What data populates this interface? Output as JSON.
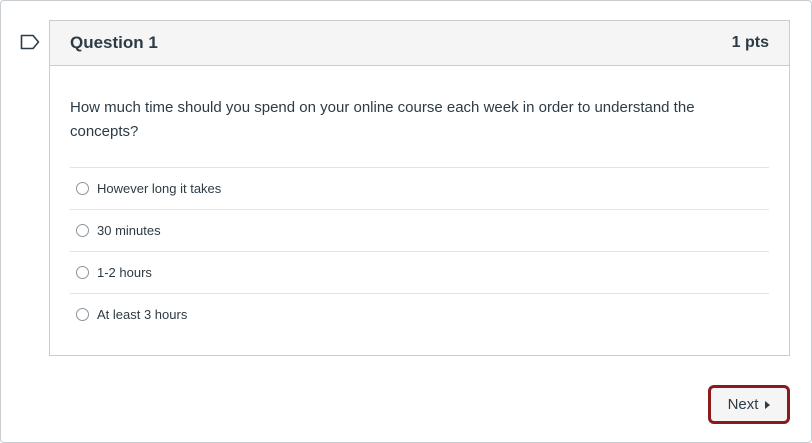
{
  "question": {
    "title": "Question 1",
    "points": "1 pts",
    "text": "How much time should you spend on your online course each week in order to understand the concepts?",
    "answers": [
      {
        "label": "However long it takes"
      },
      {
        "label": "30 minutes"
      },
      {
        "label": "1-2 hours"
      },
      {
        "label": "At least 3 hours"
      }
    ]
  },
  "navigation": {
    "next_label": "Next"
  },
  "icons": {
    "flag": "bookmark-flag-icon",
    "next": "caret-right-icon"
  },
  "colors": {
    "focus_outline": "#8b1a1a",
    "header_background": "#f5f5f5",
    "border": "#c7cdd1",
    "text": "#2d3b45"
  }
}
